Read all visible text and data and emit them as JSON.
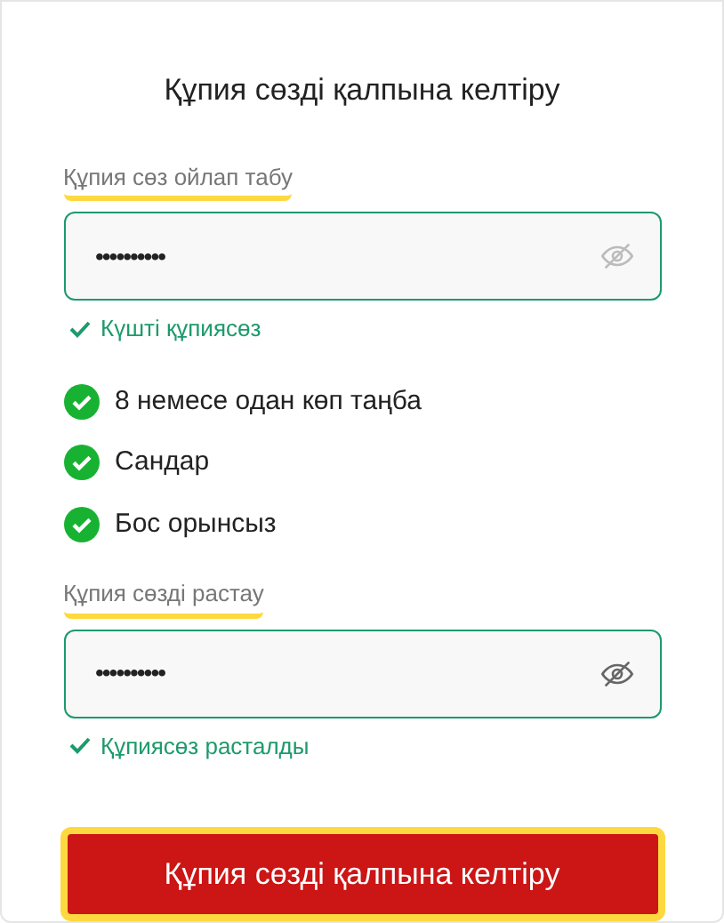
{
  "title": "Құпия сөзді қалпына келтіру",
  "fields": [
    {
      "label": "Құпия сөз ойлап табу",
      "value": "••••••••••",
      "hint": "Күшті құпиясөз",
      "valid": true
    },
    {
      "label": "Құпия сөзді растау",
      "value": "••••••••••",
      "hint": "Құпиясөз расталды",
      "valid": true
    }
  ],
  "rules": [
    {
      "text": "8 немесе одан көп таңба",
      "met": true
    },
    {
      "text": "Сандар",
      "met": true
    },
    {
      "text": "Бос орынсыз",
      "met": true
    }
  ],
  "button": {
    "label": "Құпия сөзді қалпына келтіру"
  }
}
